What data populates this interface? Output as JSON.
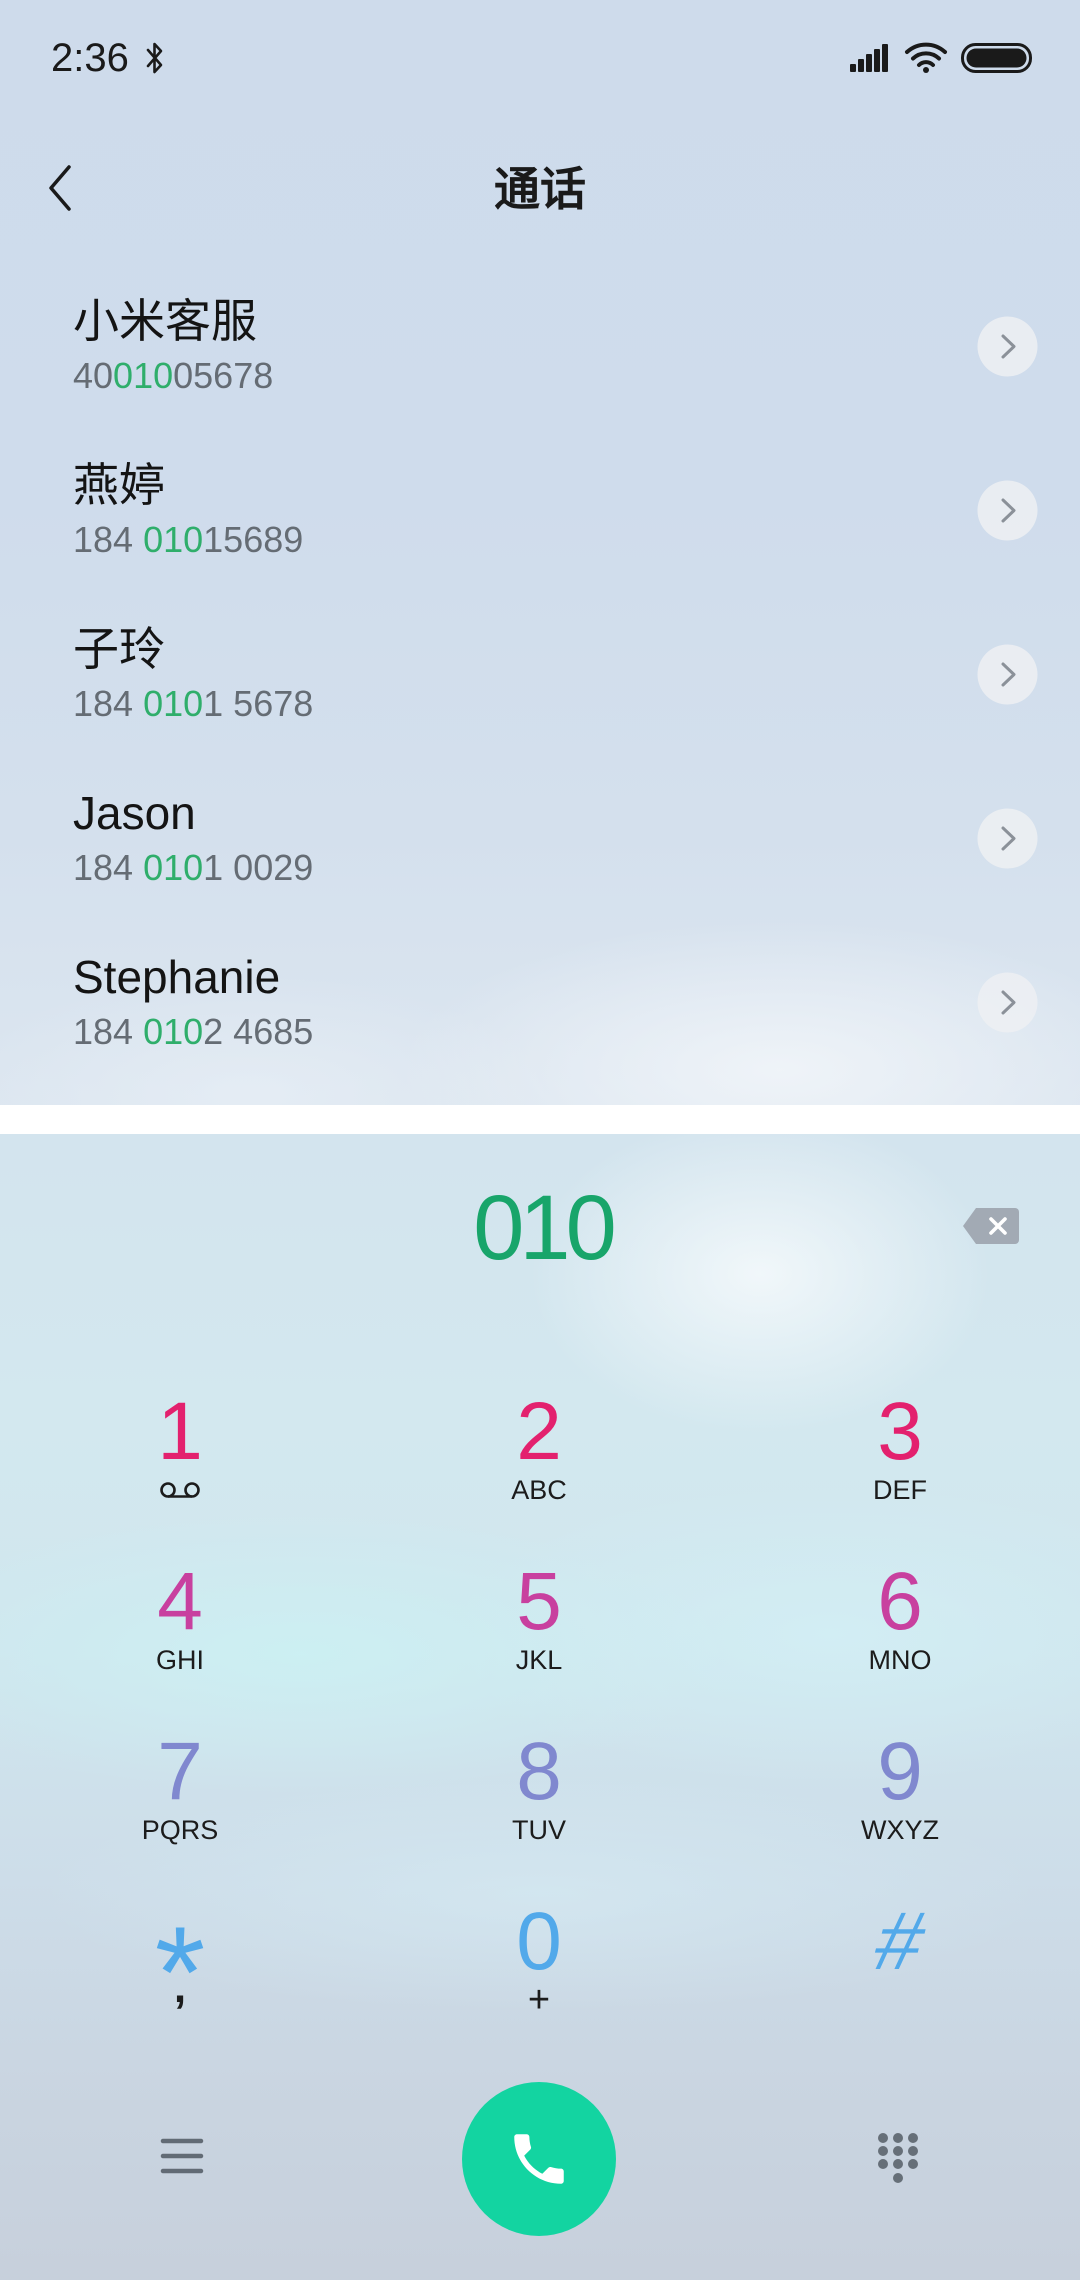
{
  "status_bar": {
    "time": "2:36",
    "bluetooth_icon": "bluetooth-icon",
    "signal_icon": "signal-icon",
    "wifi_icon": "wifi-icon",
    "battery_icon": "battery-icon"
  },
  "header": {
    "back_icon": "chevron-left-icon",
    "title": "通话"
  },
  "contacts": [
    {
      "name": "小米客服",
      "number_prefix": "40",
      "number_match": "010",
      "number_suffix": "05678"
    },
    {
      "name": "燕婷",
      "number_prefix": "184 ",
      "number_match": "010",
      "number_suffix": "15689"
    },
    {
      "name": "子玲",
      "number_prefix": "184 ",
      "number_match": "010",
      "number_suffix": "1 5678"
    },
    {
      "name": "Jason",
      "number_prefix": "184 ",
      "number_match": "010",
      "number_suffix": "1 0029"
    },
    {
      "name": "Stephanie",
      "number_prefix": "184 ",
      "number_match": "010",
      "number_suffix": "2 4685"
    }
  ],
  "contact_detail_icon": "chevron-right-icon",
  "dialer": {
    "input_value": "010",
    "backspace_icon": "backspace-icon"
  },
  "keypad": [
    {
      "digit": "1",
      "icon": "voicemail-icon"
    },
    {
      "digit": "2",
      "letters": "ABC"
    },
    {
      "digit": "3",
      "letters": "DEF"
    },
    {
      "digit": "4",
      "letters": "GHI"
    },
    {
      "digit": "5",
      "letters": "JKL"
    },
    {
      "digit": "6",
      "letters": "MNO"
    },
    {
      "digit": "7",
      "letters": "PQRS"
    },
    {
      "digit": "8",
      "letters": "TUV"
    },
    {
      "digit": "9",
      "letters": "WXYZ"
    },
    {
      "digit": "*",
      "letters": ","
    },
    {
      "digit": "0",
      "letters": "+"
    },
    {
      "digit": "#"
    }
  ],
  "bottom_bar": {
    "menu_icon": "menu-icon",
    "call_icon": "phone-icon",
    "dialpad_toggle_icon": "dialpad-icon"
  },
  "colors": {
    "match_green": "#2fae6b",
    "dialed_green": "#18a56a",
    "row1_keys": "#e3216e",
    "row2_keys": "#c8409f",
    "row3_keys": "#8088cf",
    "row4_keys": "#52a9ea",
    "call_button": "#13d4a1"
  }
}
